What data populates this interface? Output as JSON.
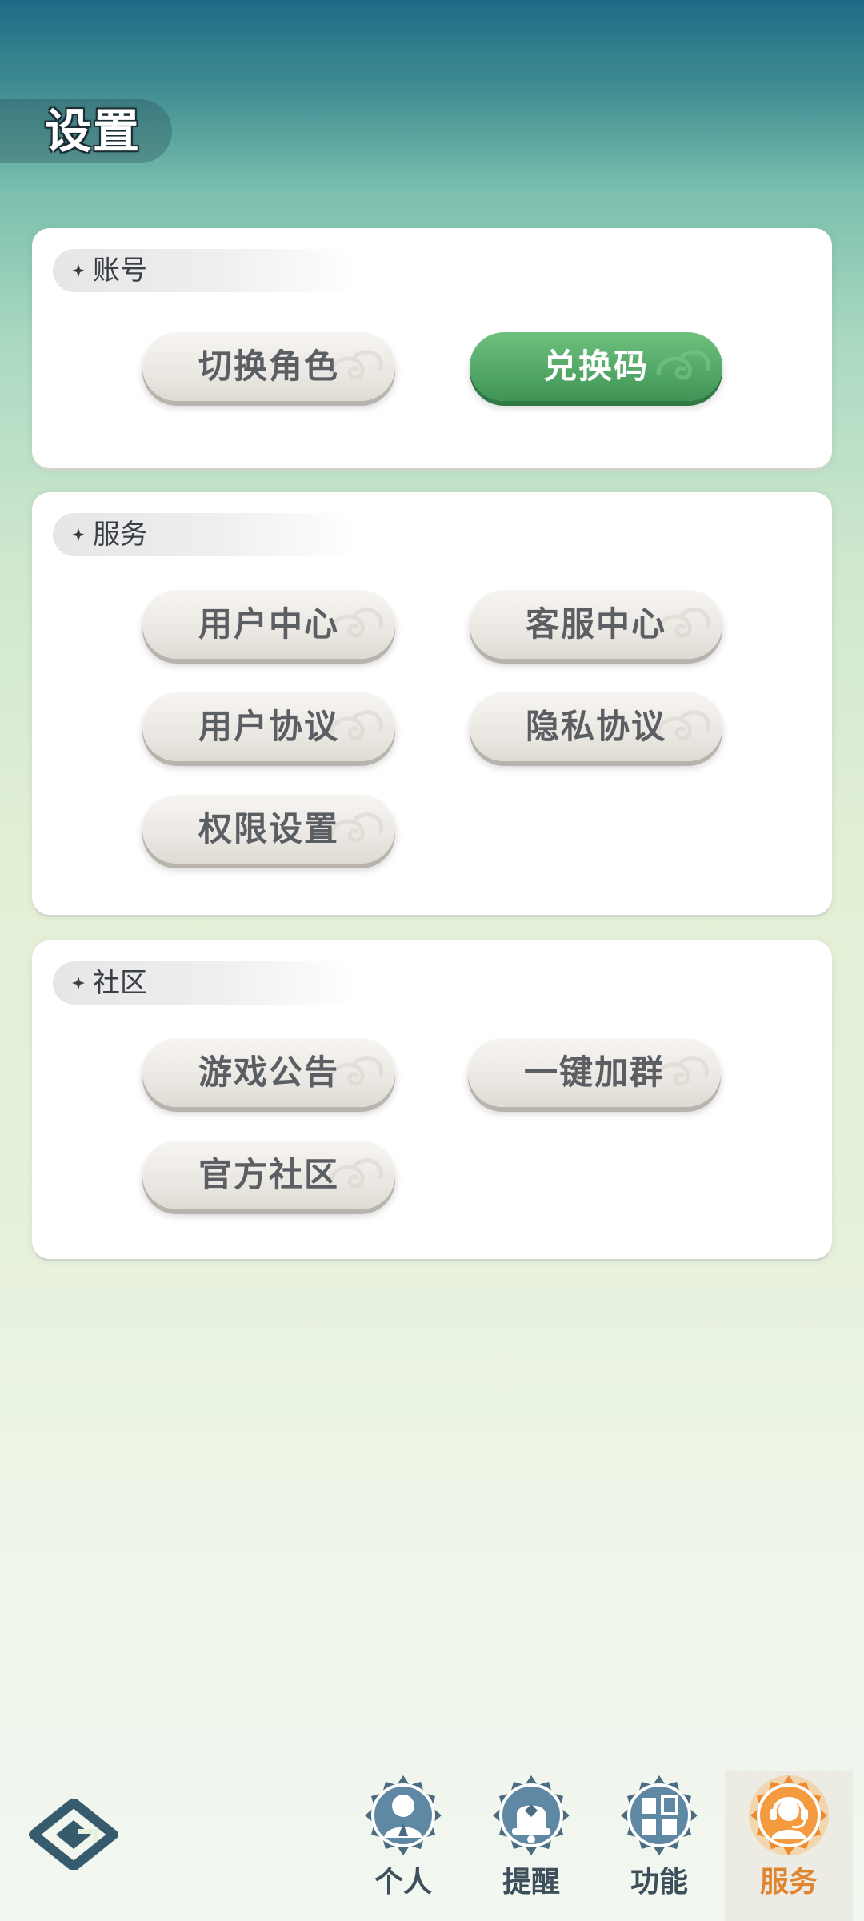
{
  "page": {
    "title": "设置"
  },
  "sections": {
    "account": {
      "title": "账号",
      "buttons": [
        "切换角色",
        "兑换码"
      ]
    },
    "service": {
      "title": "服务",
      "buttons": [
        "用户中心",
        "客服中心",
        "用户协议",
        "隐私协议",
        "权限设置"
      ]
    },
    "community": {
      "title": "社区",
      "buttons": [
        "游戏公告",
        "一键加群",
        "官方社区"
      ]
    }
  },
  "nav": {
    "items": [
      {
        "label": "个人",
        "icon": "person-icon"
      },
      {
        "label": "提醒",
        "icon": "bell-icon"
      },
      {
        "label": "功能",
        "icon": "grid-icon"
      },
      {
        "label": "服务",
        "icon": "headset-icon",
        "active": true
      }
    ]
  },
  "colors": {
    "accent_green": "#52a766",
    "active_tab": "#e0842f",
    "nav_icon": "#4a6b82"
  }
}
